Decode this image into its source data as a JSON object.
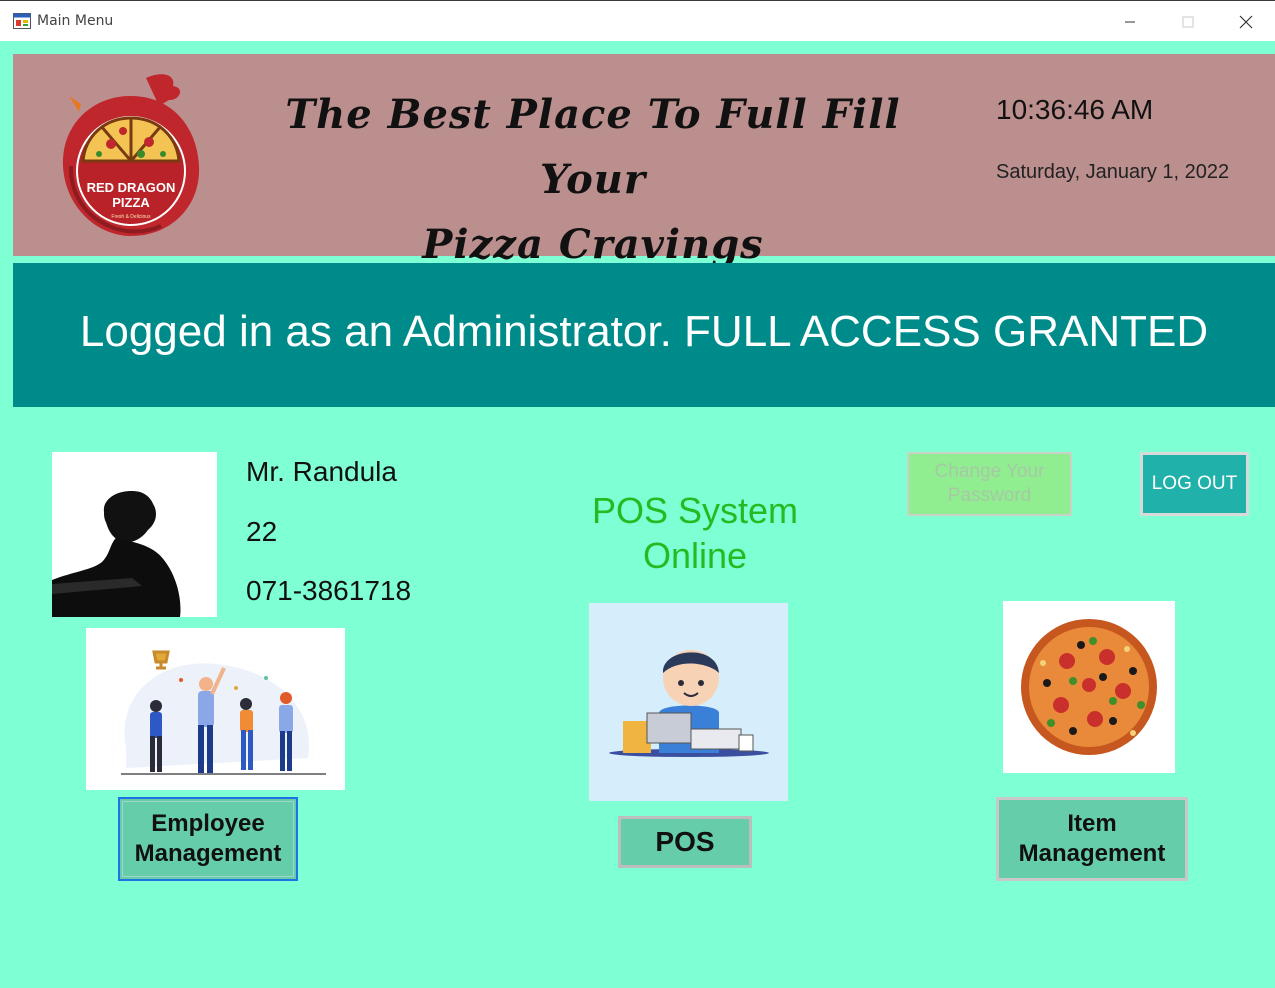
{
  "window": {
    "title": "Main Menu"
  },
  "banner": {
    "slogan_line1": "The Best Place To Full Fill Your",
    "slogan_line2": "Pizza Cravings",
    "time": "10:36:46 AM",
    "date": "Saturday, January 1, 2022",
    "logo_line1": "RED DRAGON",
    "logo_line2": "PIZZA",
    "logo_tagline": "Fresh & Delicious"
  },
  "access": {
    "message": "Logged in as an Administrator. FULL ACCESS GRANTED"
  },
  "user": {
    "name": "Mr. Randula",
    "age": "22",
    "phone": "071-3861718"
  },
  "pos_status": {
    "line1": "POS System",
    "line2": "Online"
  },
  "buttons": {
    "change_password_line1": "Change Your",
    "change_password_line2": "Password",
    "logout": "LOG OUT",
    "employee_line1": "Employee",
    "employee_line2": "Management",
    "pos": "POS",
    "item_line1": "Item",
    "item_line2": "Management"
  },
  "colors": {
    "background": "#7fffd4",
    "banner": "#bc8f8f",
    "access_bar": "#008b8b",
    "status_text": "#22bb22",
    "module_button": "#66cdaa",
    "logout_button": "#20b2aa",
    "change_password_button": "#90ee90"
  },
  "icons": [
    "app-window-icon",
    "minimize-icon",
    "maximize-icon",
    "close-icon",
    "red-dragon-pizza-logo",
    "user-silhouette-photo",
    "team-celebration-illustration",
    "cashier-pos-illustration",
    "pizza-image"
  ]
}
